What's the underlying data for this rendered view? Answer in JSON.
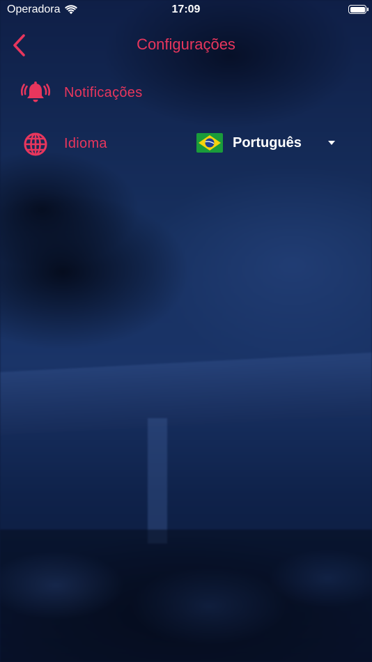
{
  "status_bar": {
    "carrier": "Operadora",
    "time": "17:09"
  },
  "nav": {
    "title": "Configurações",
    "back_icon": "chevron-left-icon"
  },
  "settings": {
    "notifications": {
      "label": "Notificações",
      "icon": "bell-ringing-icon"
    },
    "language": {
      "label": "Idioma",
      "icon": "globe-icon",
      "selected_value": "Português",
      "flag": "brazil-flag-icon"
    }
  },
  "colors": {
    "accent": "#e8365d",
    "text_on_dark": "#ffffff",
    "background": "#0d1a3a"
  }
}
